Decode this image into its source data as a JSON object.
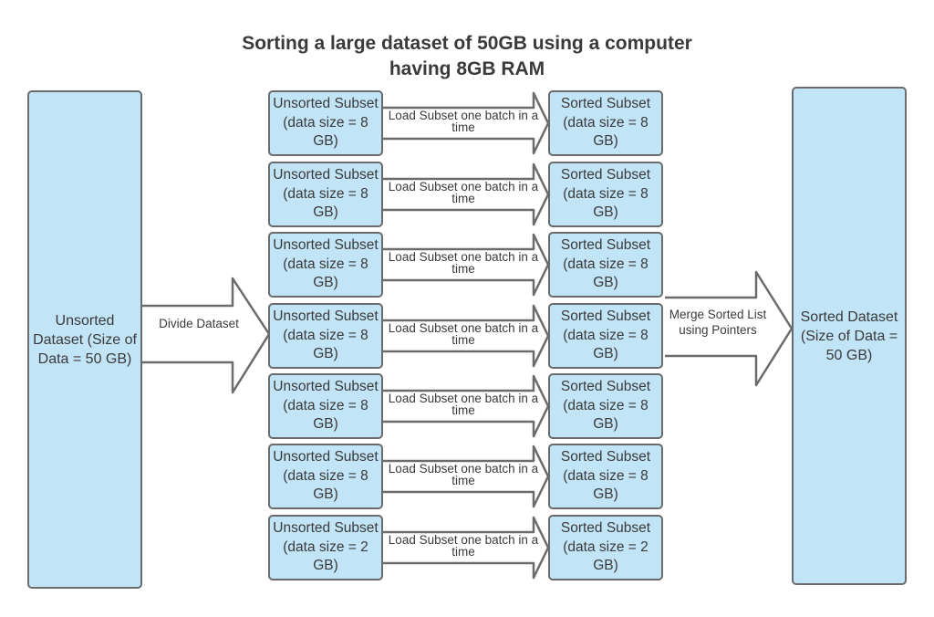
{
  "title": "Sorting a large dataset of 50GB using a computer having 8GB RAM",
  "source": {
    "label": "Unsorted Dataset (Size of Data = 50 GB)"
  },
  "target": {
    "label": "Sorted Dataset (Size of Data = 50 GB)"
  },
  "divide_arrow": {
    "label": "Divide Dataset"
  },
  "merge_arrow": {
    "label": "Merge Sorted List using Pointers"
  },
  "rows": [
    {
      "unsorted": "Unsorted Subset (data size = 8 GB)",
      "arrow": "Load Subset one batch in a time",
      "sorted": "Sorted Subset (data size = 8 GB)"
    },
    {
      "unsorted": "Unsorted Subset (data size = 8 GB)",
      "arrow": "Load Subset one batch in a time",
      "sorted": "Sorted Subset (data size = 8 GB)"
    },
    {
      "unsorted": "Unsorted Subset (data size = 8 GB)",
      "arrow": "Load Subset one batch in a time",
      "sorted": "Sorted Subset (data size = 8 GB)"
    },
    {
      "unsorted": "Unsorted Subset (data size = 8 GB)",
      "arrow": "Load Subset one batch in a time",
      "sorted": "Sorted Subset (data size = 8 GB)"
    },
    {
      "unsorted": "Unsorted Subset (data size = 8 GB)",
      "arrow": "Load Subset one batch in a time",
      "sorted": "Sorted Subset (data size = 8 GB)"
    },
    {
      "unsorted": "Unsorted Subset (data size = 8 GB)",
      "arrow": "Load Subset one batch in a time",
      "sorted": "Sorted Subset (data size = 8 GB)"
    },
    {
      "unsorted": "Unsorted Subset (data size = 2 GB)",
      "arrow": "Load Subset one batch in a time",
      "sorted": "Sorted Subset (data size = 2 GB)"
    }
  ],
  "colors": {
    "box_fill": "#c2e4f7",
    "stroke": "#6b6b6b",
    "text": "#3a3a3a"
  }
}
